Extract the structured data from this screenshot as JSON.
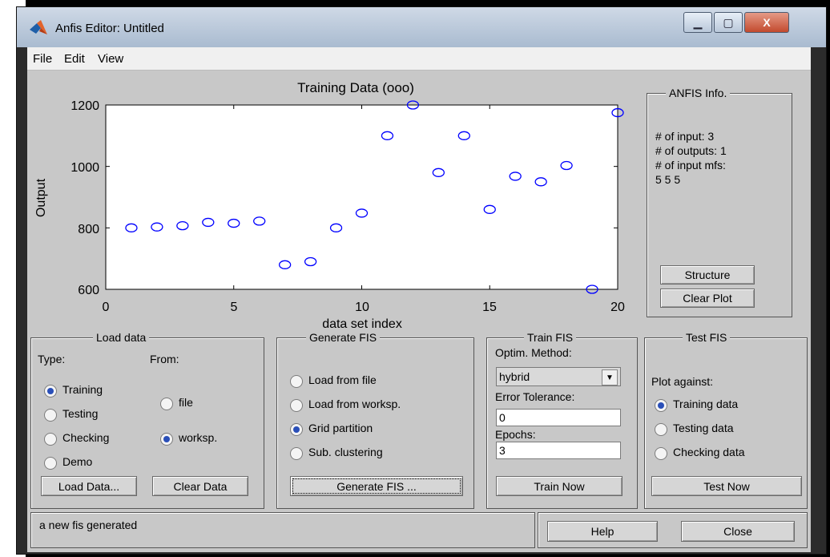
{
  "window": {
    "title": "Anfis Editor: Untitled",
    "minimize": "▁",
    "maximize": "▢",
    "close": "X"
  },
  "menu": [
    "File",
    "Edit",
    "View"
  ],
  "plot": {
    "title": "Training Data (ooo)",
    "xlabel": "data set index",
    "ylabel": "Output",
    "x_ticks": [
      "0",
      "5",
      "10",
      "15",
      "20"
    ],
    "y_ticks": [
      "600",
      "800",
      "1000",
      "1200"
    ]
  },
  "chart_data": {
    "type": "scatter",
    "title": "Training Data (ooo)",
    "xlabel": "data set index",
    "ylabel": "Output",
    "xlim": [
      0,
      20
    ],
    "ylim": [
      600,
      1200
    ],
    "marker": "o",
    "color": "#0000ff",
    "grid": false,
    "points": [
      [
        1,
        800
      ],
      [
        2,
        803
      ],
      [
        3,
        807
      ],
      [
        4,
        818
      ],
      [
        5,
        815
      ],
      [
        6,
        822
      ],
      [
        7,
        680
      ],
      [
        8,
        690
      ],
      [
        9,
        800
      ],
      [
        10,
        848
      ],
      [
        11,
        1100
      ],
      [
        12,
        1200
      ],
      [
        13,
        980
      ],
      [
        14,
        1100
      ],
      [
        15,
        860
      ],
      [
        16,
        968
      ],
      [
        17,
        950
      ],
      [
        18,
        1003
      ],
      [
        19,
        600
      ],
      [
        20,
        1175
      ]
    ]
  },
  "info": {
    "title": "ANFIS Info.",
    "lines": [
      "# of input: 3",
      "# of outputs: 1",
      "# of input mfs:",
      "5 5 5"
    ],
    "structure_button": "Structure",
    "clear_plot_button": "Clear Plot"
  },
  "load_data": {
    "title": "Load data",
    "type_label": "Type:",
    "from_label": "From:",
    "types": [
      "Training",
      "Testing",
      "Checking",
      "Demo"
    ],
    "from": [
      "file",
      "worksp."
    ],
    "load_button": "Load Data...",
    "clear_button": "Clear Data"
  },
  "generate_fis": {
    "title": "Generate FIS",
    "options": [
      "Load from file",
      "Load from worksp.",
      "Grid partition",
      "Sub. clustering"
    ],
    "button": "Generate FIS ..."
  },
  "train_fis": {
    "title": "Train FIS",
    "method_label": "Optim. Method:",
    "method_value": "hybrid",
    "tolerance_label": "Error Tolerance:",
    "tolerance_value": "0",
    "epochs_label": "Epochs:",
    "epochs_value": "3",
    "button": "Train Now"
  },
  "test_fis": {
    "title": "Test FIS",
    "plot_against_label": "Plot against:",
    "options": [
      "Training data",
      "Testing data",
      "Checking data"
    ],
    "button": "Test Now"
  },
  "status": {
    "message": "a new fis generated"
  },
  "footer": {
    "help": "Help",
    "close": "Close"
  }
}
